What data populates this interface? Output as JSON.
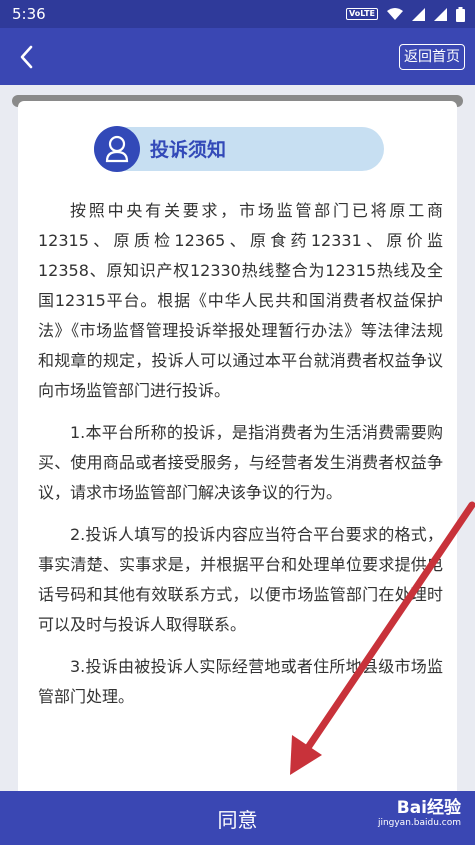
{
  "status": {
    "time": "5:36",
    "volte": "VoLTE"
  },
  "nav": {
    "home_label": "返回首页"
  },
  "notice": {
    "title": "投诉须知",
    "paragraphs": [
      "按照中央有关要求，市场监管部门已将原工商12315、原质检12365、原食药12331、原价监12358、原知识产权12330热线整合为12315热线及全国12315平台。根据《中华人民共和国消费者权益保护法》《市场监督管理投诉举报处理暂行办法》等法律法规和规章的规定，投诉人可以通过本平台就消费者权益争议向市场监管部门进行投诉。",
      "1.本平台所称的投诉，是指消费者为生活消费需要购买、使用商品或者接受服务，与经营者发生消费者权益争议，请求市场监管部门解决该争议的行为。",
      "2.投诉人填写的投诉内容应当符合平台要求的格式，事实清楚、实事求是，并根据平台和处理单位要求提供电话号码和其他有效联系方式，以便市场监管部门在处理时可以及时与投诉人取得联系。",
      "3.投诉由被投诉人实际经营地或者住所地县级市场监管部门处理。"
    ]
  },
  "footer": {
    "agree_label": "同意"
  },
  "watermark": {
    "logo": "Bai经验",
    "url": "jingyan.baidu.com"
  },
  "colors": {
    "primary": "#3a47b3",
    "accent_arrow": "#c8323a",
    "pill_bg": "#c7dff2"
  }
}
